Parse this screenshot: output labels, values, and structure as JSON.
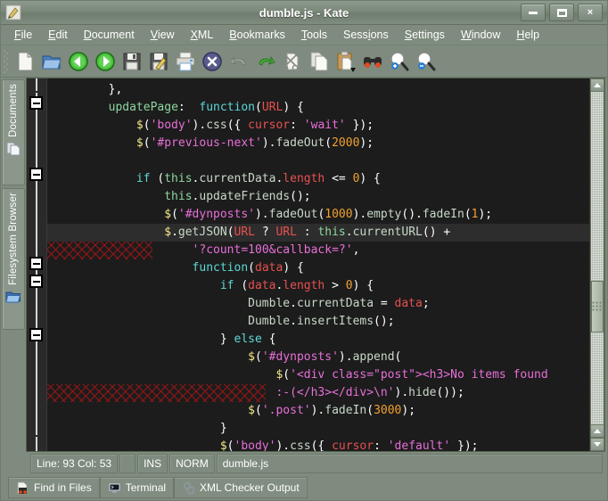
{
  "window": {
    "title": "dumble.js - Kate",
    "app_icon": "kate-pencil-icon",
    "controls": {
      "minimize": "minimize-button",
      "maximize": "maximize-button",
      "close": "×"
    }
  },
  "menubar": {
    "items": [
      {
        "label": "File",
        "accel": "F"
      },
      {
        "label": "Edit",
        "accel": "E"
      },
      {
        "label": "Document",
        "accel": "D"
      },
      {
        "label": "View",
        "accel": "V"
      },
      {
        "label": "XML",
        "accel": "X"
      },
      {
        "label": "Bookmarks",
        "accel": "B"
      },
      {
        "label": "Tools",
        "accel": "T"
      },
      {
        "label": "Sessions",
        "accel": "i"
      },
      {
        "label": "Settings",
        "accel": "S"
      },
      {
        "label": "Window",
        "accel": "W"
      },
      {
        "label": "Help",
        "accel": "H"
      }
    ]
  },
  "toolbar": {
    "items": [
      {
        "name": "new-file-icon",
        "tip": "New"
      },
      {
        "name": "open-file-icon",
        "tip": "Open"
      },
      {
        "name": "back-arrow-icon",
        "tip": "Back"
      },
      {
        "name": "forward-arrow-icon",
        "tip": "Forward"
      },
      {
        "name": "save-icon",
        "tip": "Save"
      },
      {
        "name": "save-as-icon",
        "tip": "Save As"
      },
      {
        "name": "print-icon",
        "tip": "Print"
      },
      {
        "name": "close-document-icon",
        "tip": "Close"
      },
      {
        "name": "undo-icon",
        "tip": "Undo"
      },
      {
        "name": "redo-icon",
        "tip": "Redo"
      },
      {
        "name": "cut-icon",
        "tip": "Cut"
      },
      {
        "name": "copy-icon",
        "tip": "Copy"
      },
      {
        "name": "paste-icon",
        "tip": "Paste"
      },
      {
        "name": "find-icon",
        "tip": "Find"
      },
      {
        "name": "zoom-in-icon",
        "tip": "Zoom In"
      },
      {
        "name": "zoom-out-icon",
        "tip": "Zoom Out"
      }
    ]
  },
  "sidebar": {
    "tabs": [
      {
        "label": "Documents",
        "icon": "documents-icon"
      },
      {
        "label": "Filesystem Browser",
        "icon": "folder-open-icon"
      }
    ]
  },
  "editor": {
    "highlighted_line_index": 8,
    "error_line_indices": [
      9,
      17
    ],
    "fold_markers_line_indices": [
      1,
      5,
      10,
      11,
      14
    ],
    "lines": [
      "        },",
      "        updatePage:  function(URL) {",
      "            $('body').css({ cursor: 'wait' });",
      "            $('#previous-next').fadeOut(2000);",
      "",
      "            if (this.currentData.length <= 0) {",
      "                this.updateFriends();",
      "                $('#dynposts').fadeOut(1000).empty().fadeIn(1);",
      "                $.getJSON(URL ? URL : this.currentURL() +",
      "                    '?count=100&callback=?',",
      "                    function(data) {",
      "                        if (data.length > 0) {",
      "                            Dumble.currentData = data;",
      "                            Dumble.insertItems();",
      "                        } else {",
      "                            $('#dynposts').append(",
      "                                $('<div class=\"post\"><h3>No items found",
      "                                :-(</h3></div>\\n').hide());",
      "                            $('.post').fadeIn(3000);",
      "                        }",
      "                        $('body').css({ cursor: 'default' });"
    ]
  },
  "statusbar": {
    "position": "Line: 93 Col: 53",
    "overwrite_mode": "INS",
    "selection_mode": "NORM",
    "filename": "dumble.js"
  },
  "bottom_tabs": [
    {
      "label": "Find in Files",
      "icon": "find-in-files-icon"
    },
    {
      "label": "Terminal",
      "icon": "terminal-icon"
    },
    {
      "label": "XML Checker Output",
      "icon": "xml-checker-icon"
    }
  ],
  "colors": {
    "chrome": "#7e8b7e",
    "editor_background": "#1c1c1c",
    "highlight_line": "#2d2d2d",
    "error_hatch": "#aa1414",
    "keyword": "#5fd7d7",
    "string": "#e86fd8",
    "number": "#f0a030",
    "variable": "#e85050",
    "function": "#8fd5a0"
  }
}
